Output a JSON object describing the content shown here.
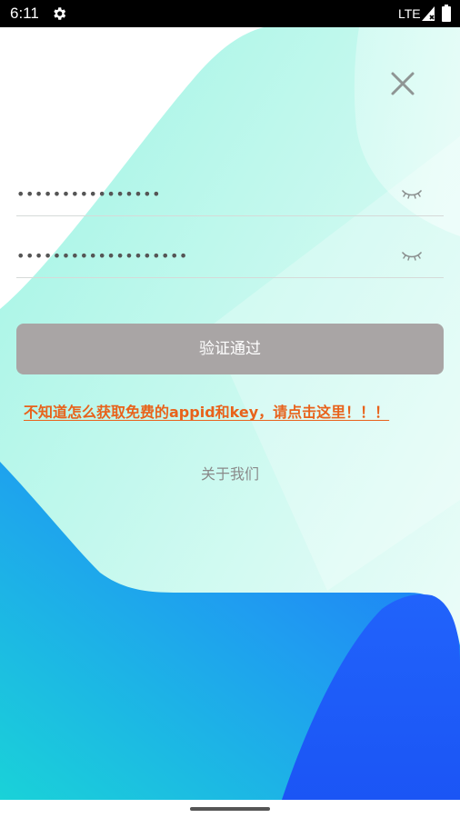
{
  "status_bar": {
    "time": "6:11",
    "network": "LTE",
    "icons": [
      "gear-icon",
      "signal-icon",
      "battery-icon"
    ]
  },
  "dialog": {
    "close_icon": "close-icon",
    "fields": [
      {
        "value": "••••••••••••••••",
        "toggle_icon": "eye-closed-icon"
      },
      {
        "value": "•••••••••••••••••••",
        "toggle_icon": "eye-closed-icon"
      }
    ],
    "verify_button": "验证通过",
    "help_link": "不知道怎么获取免费的appid和key，请点击这里！！！",
    "about_link": "关于我们"
  },
  "colors": {
    "accent_strip": "#4b3fbd",
    "button_bg": "#a9a5a5",
    "link": "#e8621b",
    "bg_cyan": "#b4f6ea",
    "bg_blue": "#1f5efc"
  }
}
